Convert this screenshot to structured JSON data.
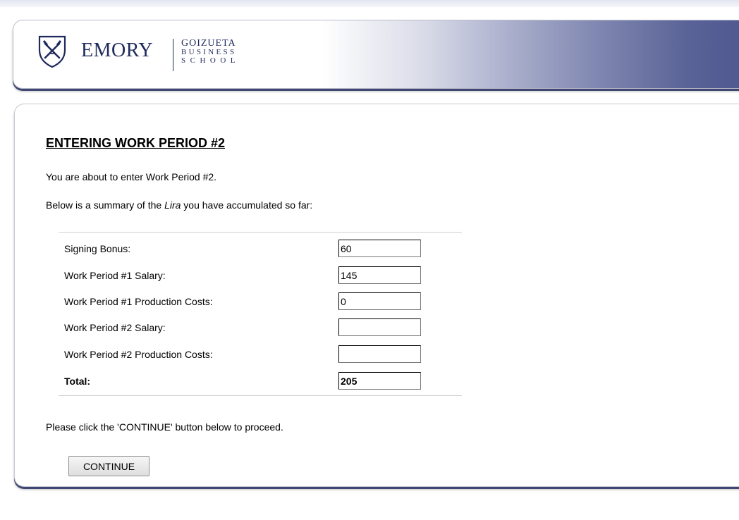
{
  "header": {
    "brand_name": "EMORY",
    "school_line1": "GOIZUETA",
    "school_line2": "BUSINESS",
    "school_line3": "SCHOOL",
    "logo_icon": "emory-shield-icon",
    "accent_color": "#4f5890"
  },
  "main": {
    "title": "ENTERING WORK PERIOD #2",
    "intro": "You are about to enter Work Period #2.",
    "summary_prefix": "Below is a summary of the ",
    "summary_currency": "Lira",
    "summary_suffix": " you have accumulated so far:",
    "rows": [
      {
        "label": "Signing Bonus:",
        "value": "60"
      },
      {
        "label": "Work Period #1 Salary:",
        "value": "145"
      },
      {
        "label": "Work Period #1 Production Costs:",
        "value": "0"
      },
      {
        "label": "Work Period #2 Salary:",
        "value": ""
      },
      {
        "label": "Work Period #2 Production Costs:",
        "value": ""
      },
      {
        "label": "Total:",
        "value": "205"
      }
    ],
    "instruction": "Please click the 'CONTINUE' button below to proceed.",
    "continue_label": "CONTINUE"
  }
}
